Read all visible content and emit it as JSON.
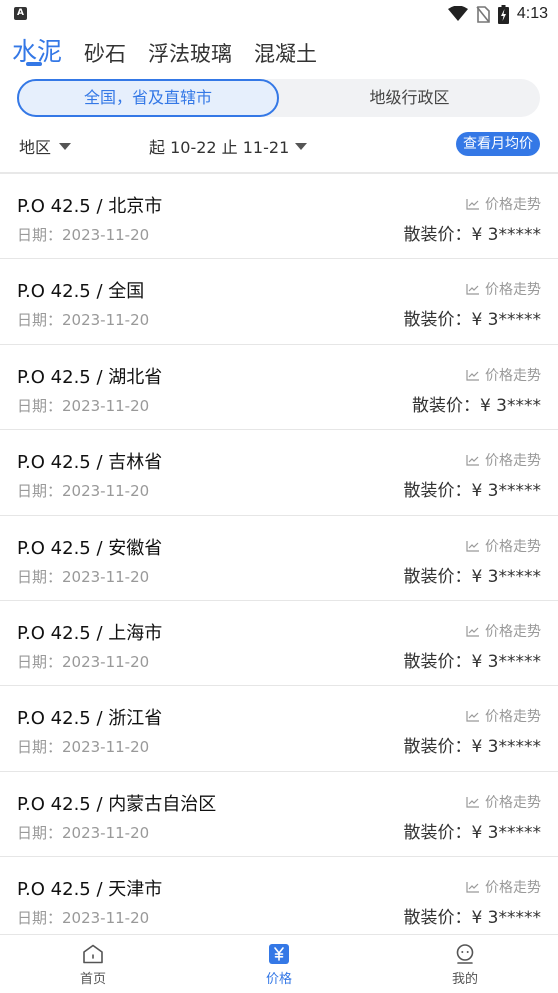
{
  "status_bar": {
    "time": "4:13",
    "left_icon": "A"
  },
  "category_tabs": [
    {
      "label": "水泥",
      "active": true
    },
    {
      "label": "砂石",
      "active": false
    },
    {
      "label": "浮法玻璃",
      "active": false
    },
    {
      "label": "混凝土",
      "active": false
    }
  ],
  "segment": {
    "left_label": "全国，省及直辖市",
    "right_label": "地级行政区"
  },
  "filter": {
    "region_label": "地区",
    "date_label": "起 10-22 止 11-21",
    "monthly_button": "查看月均价"
  },
  "list": {
    "trend_label": "价格走势",
    "rows": [
      {
        "title": "P.O 42.5 / 北京市",
        "date": "日期：2023-11-20",
        "price": "散装价：¥ 3*****"
      },
      {
        "title": "P.O 42.5 / 全国",
        "date": "日期：2023-11-20",
        "price": "散装价：¥ 3*****"
      },
      {
        "title": "P.O 42.5 / 湖北省",
        "date": "日期：2023-11-20",
        "price": "散装价：¥ 3****"
      },
      {
        "title": "P.O 42.5 / 吉林省",
        "date": "日期：2023-11-20",
        "price": "散装价：¥ 3*****"
      },
      {
        "title": "P.O 42.5 / 安徽省",
        "date": "日期：2023-11-20",
        "price": "散装价：¥ 3*****"
      },
      {
        "title": "P.O 42.5 / 上海市",
        "date": "日期：2023-11-20",
        "price": "散装价：¥ 3*****"
      },
      {
        "title": "P.O 42.5 / 浙江省",
        "date": "日期：2023-11-20",
        "price": "散装价：¥ 3*****"
      },
      {
        "title": "P.O 42.5 / 内蒙古自治区",
        "date": "日期：2023-11-20",
        "price": "散装价：¥ 3*****"
      },
      {
        "title": "P.O 42.5 / 天津市",
        "date": "日期：2023-11-20",
        "price": "散装价：¥ 3*****"
      }
    ]
  },
  "bottom_nav": [
    {
      "label": "首页",
      "icon": "home-icon",
      "active": false
    },
    {
      "label": "价格",
      "icon": "yuan-icon",
      "active": true
    },
    {
      "label": "我的",
      "icon": "profile-icon",
      "active": false
    }
  ],
  "colors": {
    "accent": "#3478e6",
    "muted": "#999999"
  }
}
